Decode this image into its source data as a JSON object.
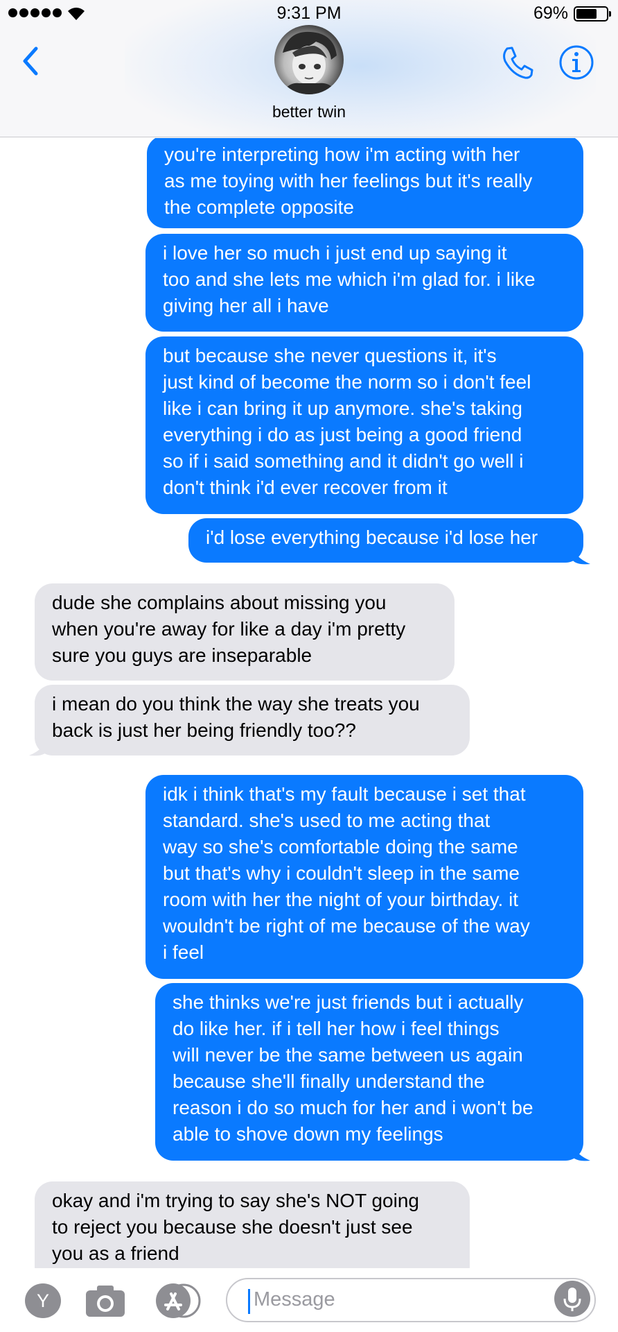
{
  "status_bar": {
    "time": "9:31 PM",
    "battery_percent": "69%",
    "battery_level": 0.69,
    "signal_bars": 5
  },
  "header": {
    "contact_name": "better twin",
    "icons": [
      "chevron-left-icon",
      "phone-icon",
      "info-icon"
    ],
    "accent_color": "#0a7aff"
  },
  "messages": [
    {
      "direction": "sent",
      "text": "you're interpreting how i'm acting with her\nas me toying with her feelings but it's really\nthe complete opposite"
    },
    {
      "direction": "sent",
      "text": "i love her so much i just end up saying it\ntoo and she lets me which i'm glad for. i like\ngiving her all i have"
    },
    {
      "direction": "sent",
      "text": "but because she never questions it, it's\njust kind of become the norm so i don't feel\nlike i can bring it up anymore. she's taking\neverything i do as just being a good friend\nso if i said something and it didn't go well i\ndon't think i'd ever recover from it"
    },
    {
      "direction": "sent",
      "text": "i'd lose everything because i'd lose her"
    },
    {
      "direction": "received",
      "text": "dude she complains about missing you\nwhen you're away for like a day i'm pretty\nsure you guys are inseparable"
    },
    {
      "direction": "received",
      "text": "i mean do you think the way she treats you\nback is just her being friendly too??"
    },
    {
      "direction": "sent",
      "text": "idk i think that's my fault because i set that\nstandard. she's used to me acting that\nway so she's comfortable doing the same\nbut that's why i couldn't sleep in the same\nroom with her the night of your birthday. it\nwouldn't be right of me because of the way\ni feel"
    },
    {
      "direction": "sent",
      "text": "she thinks we're just friends but i actually\ndo like her. if i tell her how i feel things\nwill never be the same between us again\nbecause she'll finally understand the\nreason i do so much for her and i won't be\nable to shove down my feelings"
    },
    {
      "direction": "received",
      "text": "okay and i'm trying to say she's NOT going\nto reject you because she doesn't just see\nyou as a friend"
    }
  ],
  "input_bar": {
    "placeholder": "Message",
    "app_button_letter": "Y",
    "icons": [
      "y-app-icon",
      "camera-icon",
      "app-store-icon",
      "microphone-icon"
    ]
  },
  "colors": {
    "sent_bubble": "#0a7aff",
    "received_bubble": "#e5e5ea"
  }
}
